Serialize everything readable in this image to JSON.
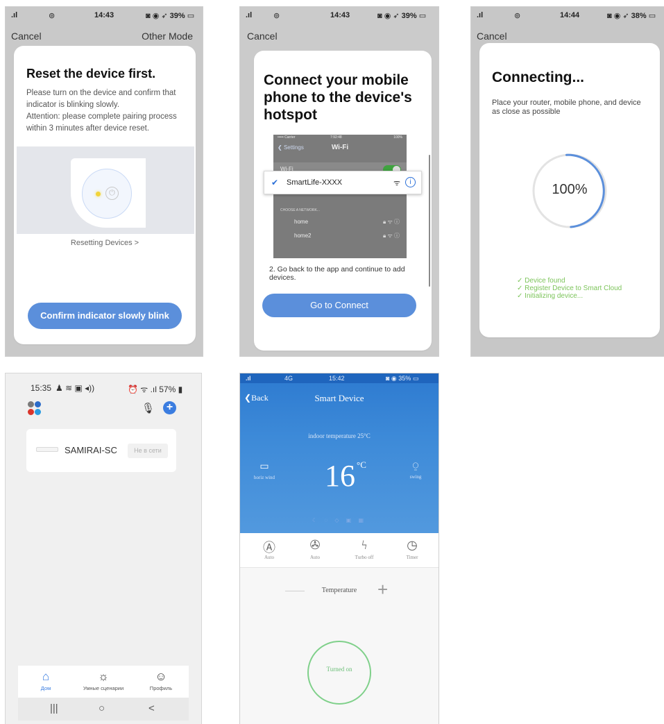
{
  "screen1": {
    "status": {
      "time": "14:43",
      "battery": "39%"
    },
    "nav": {
      "cancel": "Cancel",
      "other_mode": "Other Mode"
    },
    "title": "Reset the device first.",
    "desc_line1": "Please turn on the device and confirm that indicator is blinking slowly.",
    "desc_line2": "Attention: please complete pairing process within 3 minutes after device reset.",
    "resetting_link": "Resetting Devices >",
    "confirm_button": "Confirm indicator slowly blink"
  },
  "screen2": {
    "status": {
      "time": "14:43",
      "battery": "39%"
    },
    "nav": {
      "cancel": "Cancel"
    },
    "title": "Connect your mobile phone to the device's hotspot",
    "wifi_shot": {
      "carrier": "••••• Carrier",
      "time": "7:92:48",
      "battery": "100%",
      "back": "Settings",
      "title": "Wi-Fi",
      "wifi_label": "Wi-Fi",
      "selected_ssid": "SmartLife-XXXX",
      "section": "CHOOSE A NETWORK...",
      "networks": [
        "home",
        "home2"
      ]
    },
    "step_text": "2. Go back to the app and continue to add devices.",
    "connect_button": "Go to Connect"
  },
  "screen3": {
    "status": {
      "time": "14:44",
      "battery": "38%"
    },
    "nav": {
      "cancel": "Cancel"
    },
    "title": "Connecting...",
    "desc": "Place your router, mobile phone, and device as close as possible",
    "progress_text": "100%",
    "progress": 1.0,
    "steps": [
      "Device found",
      "Register Device to Smart Cloud",
      "Initializing device..."
    ],
    "accent_color": "#5b8fdb",
    "step_color": "#7cc45a"
  },
  "screen4": {
    "status": {
      "time": "15:35",
      "battery": "57%"
    },
    "device": {
      "name": "SAMIRAI-SC",
      "status": "Не в сети"
    },
    "tabs": [
      {
        "icon": "home-icon",
        "label": "Дом"
      },
      {
        "icon": "sun-icon",
        "label": "Умные сценарии"
      },
      {
        "icon": "profile-icon",
        "label": "Профиль"
      }
    ],
    "sysnav": {
      "recent": "|||",
      "home": "○",
      "back": "<"
    }
  },
  "screen5": {
    "status": {
      "signal": "4G",
      "time": "15:42",
      "battery": "35%"
    },
    "back": "Back",
    "title": "Smart Device",
    "indoor": "indoor temperature  25°C",
    "temperature": "16",
    "unit": "°C",
    "left_ctrl": {
      "icon": "horizontal-wind-icon",
      "label": "horiz wind"
    },
    "right_ctrl": {
      "icon": "swing-icon",
      "label": "swing"
    },
    "modes": [
      {
        "icon": "auto-mode-icon",
        "label": "Auto"
      },
      {
        "icon": "fan-icon",
        "label": "Auto"
      },
      {
        "icon": "turbo-icon",
        "label": "Turbo off"
      },
      {
        "icon": "timer-icon",
        "label": "Timer"
      }
    ],
    "temp_label": "Temperature",
    "power_label": "Turned on",
    "brand_color": "#2d7ad0"
  }
}
